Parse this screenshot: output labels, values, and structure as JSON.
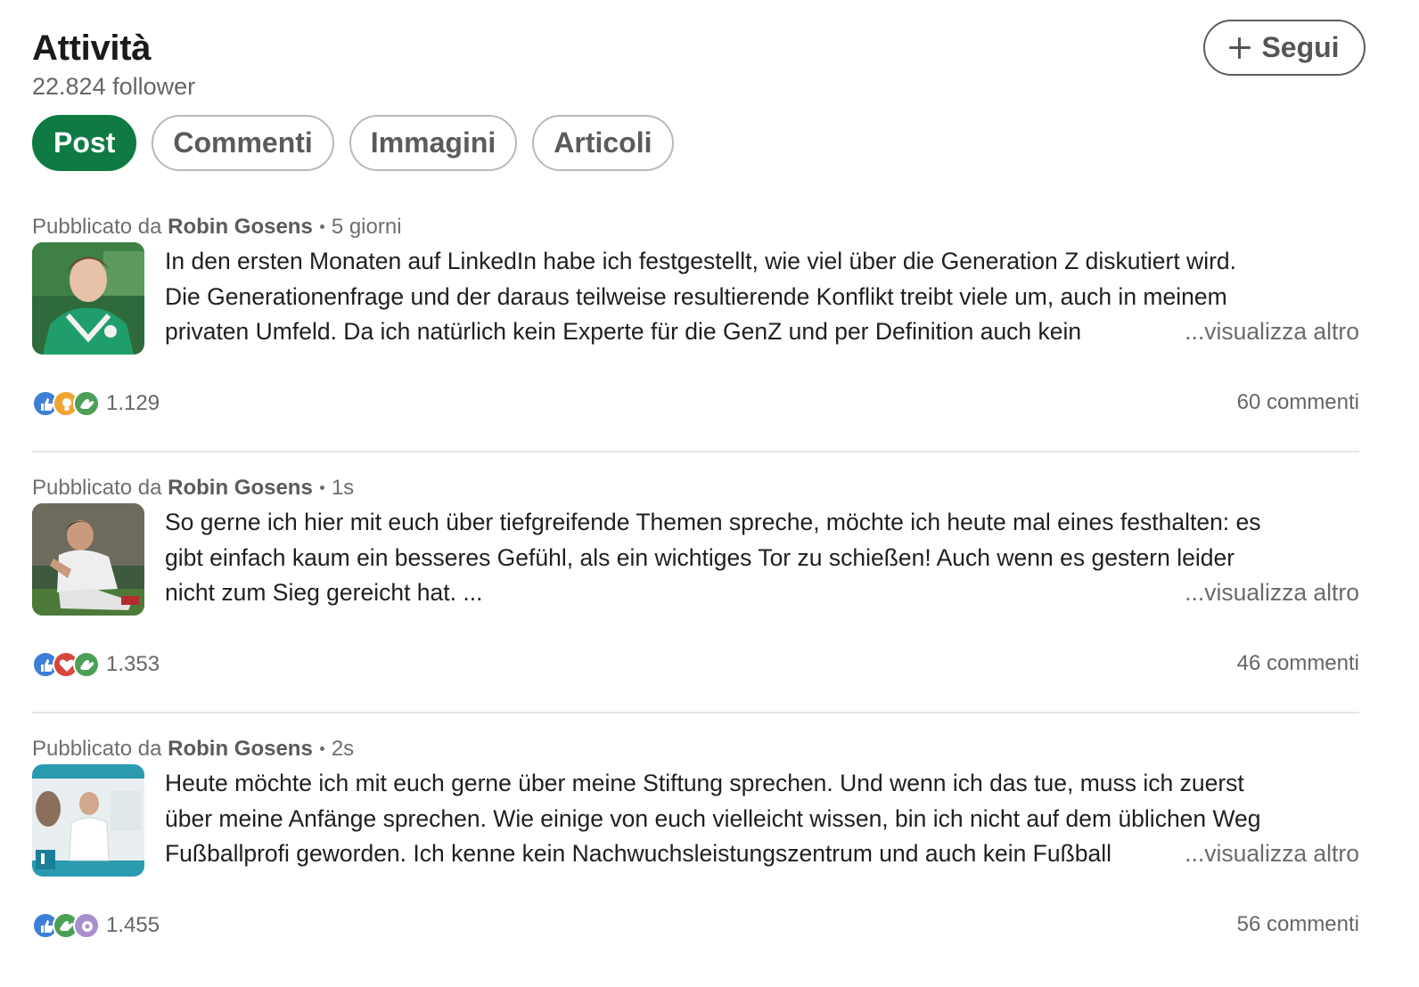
{
  "header": {
    "title": "Attività",
    "followers": "22.824 follower",
    "follow_label": "Segui"
  },
  "tabs": [
    {
      "label": "Post",
      "active": true
    },
    {
      "label": "Commenti",
      "active": false
    },
    {
      "label": "Immagini",
      "active": false
    },
    {
      "label": "Articoli",
      "active": false
    }
  ],
  "colors": {
    "accent": "#0f7a43",
    "like": "#3d7fd6",
    "idea": "#f0a531",
    "support": "#4d9f58",
    "love": "#d6473c",
    "curious": "#a98fce"
  },
  "posts": [
    {
      "prefix": "Pubblicato da",
      "author": "Robin Gosens",
      "age": "5 giorni",
      "lines": [
        "In den ersten Monaten auf LinkedIn habe ich festgestellt, wie viel über die Generation Z diskutiert wird.",
        "Die Generationenfrage und der daraus teilweise resultierende Konflikt treibt viele um, auch in meinem",
        "privaten Umfeld. Da ich natürlich kein Experte für die GenZ und per Definition auch kein"
      ],
      "more": "...visualizza altro",
      "reactions": [
        "like",
        "idea",
        "support"
      ],
      "reaction_count": "1.129",
      "comments": "60 commenti"
    },
    {
      "prefix": "Pubblicato da",
      "author": "Robin Gosens",
      "age": "1s",
      "lines": [
        "So gerne ich hier mit euch über tiefgreifende Themen spreche, möchte ich heute mal eines festhalten: es",
        "gibt einfach kaum ein besseres Gefühl, als ein wichtiges Tor zu schießen! Auch wenn es gestern leider",
        "nicht zum Sieg gereicht hat. ..."
      ],
      "more": "...visualizza altro",
      "reactions": [
        "like",
        "love",
        "support"
      ],
      "reaction_count": "1.353",
      "comments": "46 commenti"
    },
    {
      "prefix": "Pubblicato da",
      "author": "Robin Gosens",
      "age": "2s",
      "lines": [
        "Heute möchte ich mit euch gerne über meine Stiftung sprechen. Und wenn ich das tue, muss ich zuerst",
        "über meine Anfänge sprechen. Wie einige von euch vielleicht wissen, bin ich nicht auf dem üblichen Weg",
        "Fußballprofi geworden. Ich kenne kein Nachwuchsleistungszentrum und auch kein Fußball"
      ],
      "more": "...visualizza altro",
      "reactions": [
        "like",
        "support",
        "curious"
      ],
      "reaction_count": "1.455",
      "comments": "56 commenti"
    }
  ]
}
